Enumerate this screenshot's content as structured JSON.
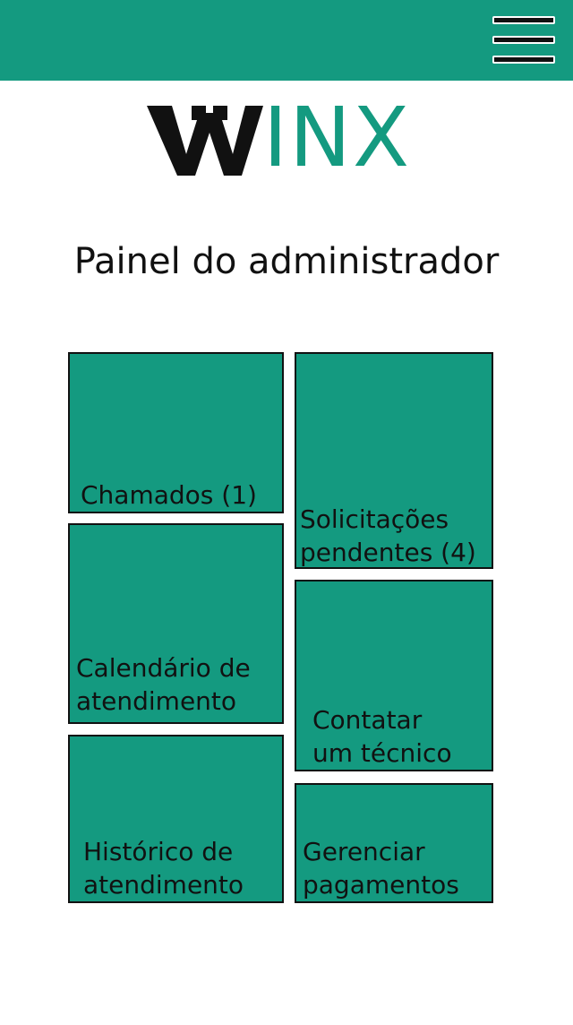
{
  "header": {
    "menu_icon": "hamburger-menu-icon"
  },
  "logo": {
    "text": "INX",
    "mark_icon": "wrench-w-logo-icon",
    "mark_color": "#111111",
    "text_color": "#149a80"
  },
  "page": {
    "title": "Painel do administrador"
  },
  "tiles": [
    {
      "line1": "Chamados (1)",
      "line2": ""
    },
    {
      "line1": "Solicitações",
      "line2": "pendentes (4)"
    },
    {
      "line1": "Calendário de",
      "line2": "atendimento"
    },
    {
      "line1": "Contatar",
      "line2": "um técnico"
    },
    {
      "line1": "Histórico de",
      "line2": "atendimento"
    },
    {
      "line1": "Gerenciar",
      "line2": "pagamentos"
    }
  ],
  "colors": {
    "accent": "#149a80",
    "text": "#111111",
    "background": "#ffffff"
  }
}
